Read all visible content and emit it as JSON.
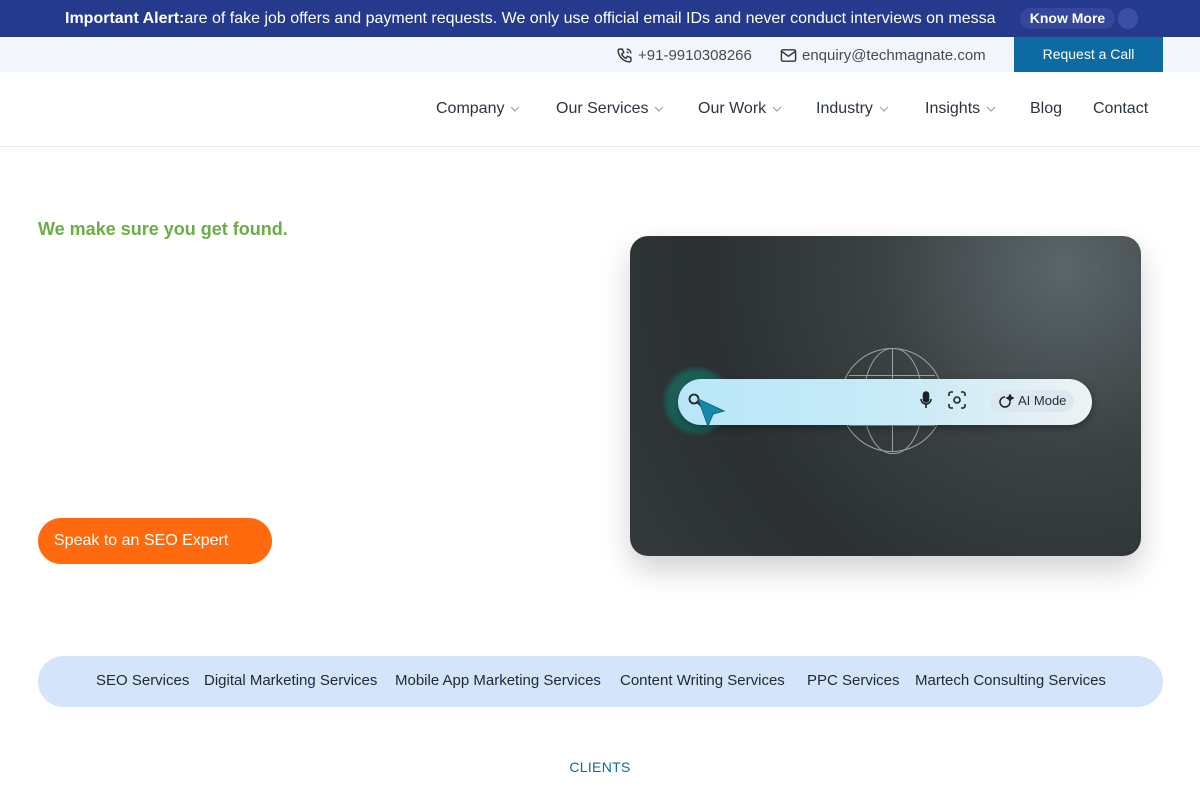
{
  "alert": {
    "prefix": "Important Alert:",
    "message": "are of fake job offers and payment requests. We only use official email IDs and never conduct interviews on messa",
    "know_more": "Know More"
  },
  "contact": {
    "phone": "+91-9910308266",
    "email": "enquiry@techmagnate.com",
    "request_call": "Request a Call"
  },
  "nav": {
    "items": [
      {
        "label": "Company",
        "dropdown": true
      },
      {
        "label": "Our Services",
        "dropdown": true
      },
      {
        "label": "Our Work",
        "dropdown": true
      },
      {
        "label": "Industry",
        "dropdown": true
      },
      {
        "label": "Insights",
        "dropdown": true
      },
      {
        "label": "Blog",
        "dropdown": false
      },
      {
        "label": "Contact",
        "dropdown": false
      }
    ]
  },
  "hero": {
    "tagline": "We make sure you get found.",
    "cta": "Speak to an SEO Expert",
    "search_mock": {
      "ai_mode_label": "AI Mode"
    }
  },
  "services": [
    "SEO Services",
    "Digital Marketing Services",
    "Mobile App Marketing Services",
    "Content Writing Services",
    "PPC Services",
    "Martech Consulting Services"
  ],
  "clients_heading": "CLIENTS",
  "colors": {
    "alert_bg": "#253a8c",
    "primary_blue": "#0d6aa3",
    "tagline_green": "#6aae45",
    "cta_orange": "#ff6a0f",
    "services_bg": "#d4e4fb"
  },
  "icons": [
    "phone-icon",
    "mail-icon",
    "chevron-down-icon",
    "search-icon",
    "cursor-icon",
    "mic-icon",
    "lens-icon",
    "sparkle-icon",
    "globe-icon"
  ]
}
